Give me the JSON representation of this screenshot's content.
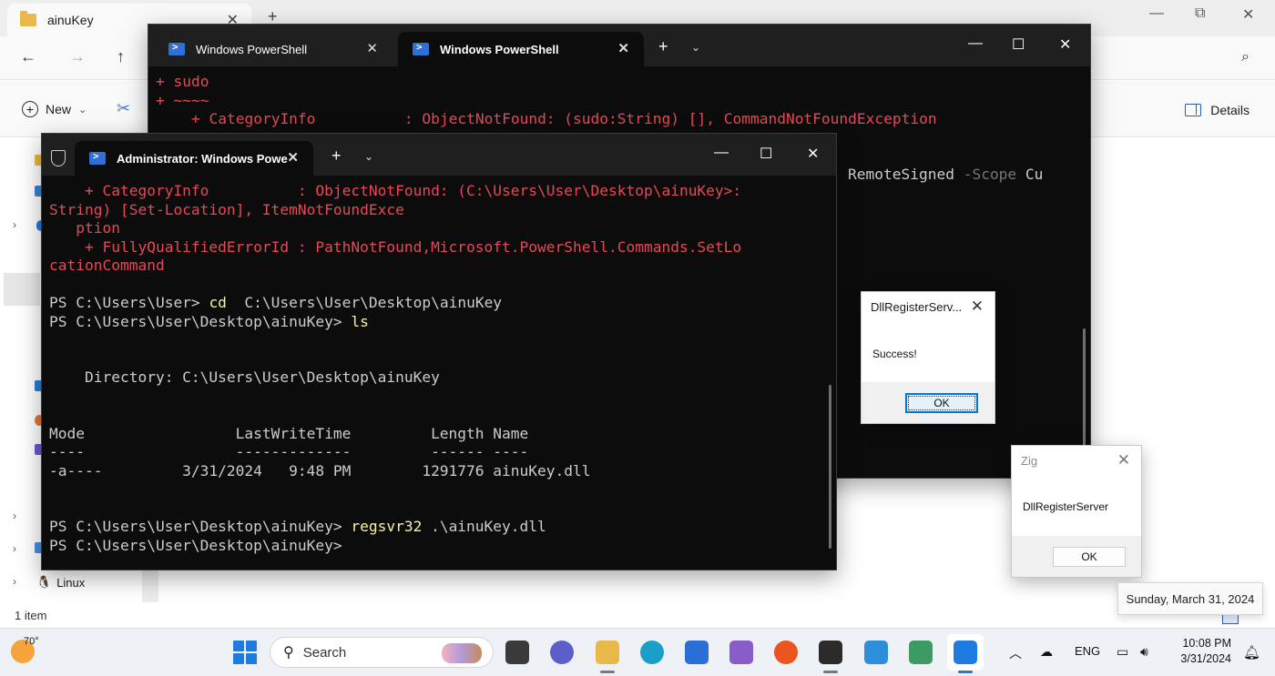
{
  "explorer": {
    "tab_title": "ainuKey",
    "tab_close": "✕",
    "new_tab": "+",
    "win_controls": [
      "—",
      "⧉",
      "✕"
    ],
    "nav": {
      "back": "←",
      "forward": "→",
      "up": "↑"
    },
    "search_icon": "⌕",
    "cmd": {
      "new_label": "New",
      "new_chevron": "⌄",
      "details_label": "Details"
    },
    "sidebar_linux": "Linux",
    "status": "1 item"
  },
  "back_terminal": {
    "tabs": [
      {
        "title": "Windows PowerShell",
        "icon": "powershell-icon"
      },
      {
        "title": "Windows PowerShell",
        "icon": "powershell-icon"
      }
    ],
    "add": "+",
    "dropdown": "⌄",
    "controls": [
      "—",
      "☐",
      "✕"
    ],
    "lines": {
      "l1": "+ sudo",
      "l2": "+ ~~~~",
      "l3": "    + CategoryInfo          : ObjectNotFound: (sudo:String) [], CommandNotFoundException",
      "l4a": "RemoteSigned ",
      "l4b": "-Scope",
      "l4c": " Cu"
    }
  },
  "front_terminal": {
    "tab_title": "Administrator: Windows Powe",
    "add": "+",
    "dropdown": "⌄",
    "controls": [
      "—",
      "☐",
      "✕"
    ],
    "lines": {
      "e1": "    + CategoryInfo          : ObjectNotFound: (C:\\Users\\User\\Desktop\\ainuKey>:",
      "e2": "String) [Set-Location], ItemNotFoundExce",
      "e3": "   ption",
      "e4": "    + FullyQualifiedErrorId : PathNotFound,Microsoft.PowerShell.Commands.SetLo",
      "e5": "cationCommand",
      "p1": "PS C:\\Users\\User> ",
      "p1cmd": "cd",
      "p1arg": "  C:\\Users\\User\\Desktop\\ainuKey",
      "p2": "PS C:\\Users\\User\\Desktop\\ainuKey> ",
      "p2cmd": "ls",
      "dir": "    Directory: C:\\Users\\User\\Desktop\\ainuKey",
      "hdr": "Mode                 LastWriteTime         Length Name",
      "sep": "----                 -------------         ------ ----",
      "row": "-a----         3/31/2024   9:48 PM        1291776 ainuKey.dll",
      "p3": "PS C:\\Users\\User\\Desktop\\ainuKey> ",
      "p3cmd": "regsvr32",
      "p3arg": " .\\ainuKey.dll",
      "p4": "PS C:\\Users\\User\\Desktop\\ainuKey>"
    }
  },
  "dialog_success": {
    "title": "DllRegisterServ...",
    "close": "✕",
    "message": "Success!",
    "ok": "OK"
  },
  "dialog_zig": {
    "title": "Zig",
    "close": "✕",
    "message": "DllRegisterServer",
    "ok": "OK"
  },
  "tooltip": "Sunday, March 31, 2024",
  "taskbar": {
    "weather_temp": "70°",
    "search_label": "Search",
    "language": "ENG",
    "time": "10:08 PM",
    "date": "3/31/2024"
  },
  "colors": {
    "terminal_bg": "#0c0c0c",
    "error_red": "#e74856",
    "command_yellow": "#f9f1a5",
    "accent_blue": "#0078d7"
  }
}
